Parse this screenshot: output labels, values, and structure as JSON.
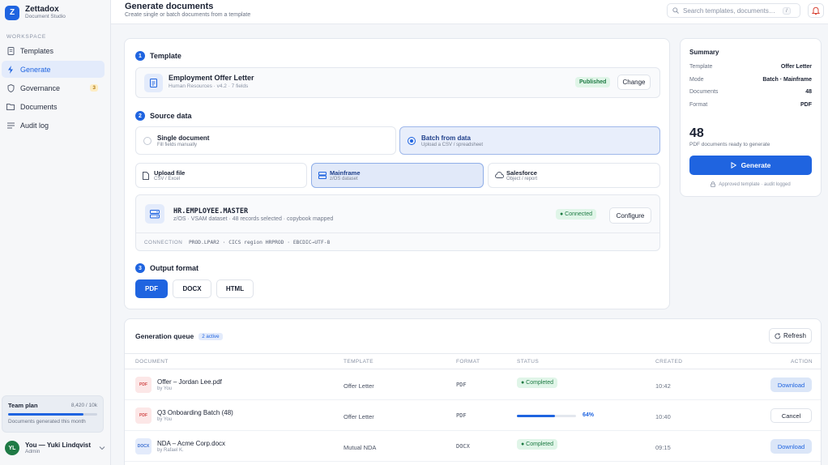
{
  "brand": {
    "name": "Zettadox",
    "subtitle": "Document Studio",
    "logo_letter": "Z"
  },
  "sidebar": {
    "section_label": "WORKSPACE",
    "items": [
      {
        "label": "Templates",
        "icon": "file-icon"
      },
      {
        "label": "Generate",
        "icon": "bolt-icon",
        "active": true
      },
      {
        "label": "Governance",
        "icon": "shield-icon",
        "badge": "3"
      },
      {
        "label": "Documents",
        "icon": "folder-icon"
      },
      {
        "label": "Audit log",
        "icon": "list-icon"
      }
    ],
    "plan": {
      "title": "Team plan",
      "count": "8,420 / 10k",
      "caption": "Documents generated this month",
      "usage_fraction": 0.842
    },
    "user": {
      "initials": "YL",
      "name": "You — Yuki Lindqvist",
      "role": "Admin"
    }
  },
  "header": {
    "title": "Generate documents",
    "subtitle": "Create single or batch documents from a template",
    "search_placeholder": "Search templates, documents…",
    "search_shortcut": "/"
  },
  "template": {
    "step": "1",
    "heading": "Template",
    "name": "Employment Offer Letter",
    "meta": "Human Resources · v4.2 · 7 fields",
    "status": "Published",
    "change_label": "Change"
  },
  "source": {
    "step": "2",
    "heading": "Source data",
    "modes": [
      {
        "title": "Single document",
        "subtitle": "Fill fields manually",
        "selected": false
      },
      {
        "title": "Batch from data",
        "subtitle": "Upload a CSV / spreadsheet",
        "selected": true
      }
    ],
    "sources": [
      {
        "title": "Upload file",
        "subtitle": "CSV / Excel",
        "icon": "file-icon"
      },
      {
        "title": "Mainframe",
        "subtitle": "z/OS dataset",
        "icon": "server-icon",
        "selected": true
      },
      {
        "title": "Salesforce",
        "subtitle": "Object / report",
        "icon": "cloud-icon"
      }
    ],
    "mainframe": {
      "dataset": "HR.EMPLOYEE.MASTER",
      "meta": "z/OS · VSAM dataset · 48 records selected · copybook mapped",
      "status": "● Connected",
      "configure_label": "Configure",
      "connection_label": "CONNECTION",
      "connection_value": "PROD.LPAR2 · CICS region HRPROD · EBCDIC→UTF-8"
    }
  },
  "output": {
    "step": "3",
    "heading": "Output format",
    "formats": [
      "PDF",
      "DOCX",
      "HTML"
    ],
    "selected": "PDF"
  },
  "summary": {
    "title": "Summary",
    "rows": [
      {
        "key": "Template",
        "value": "Offer Letter"
      },
      {
        "key": "Mode",
        "value": "Batch · Mainframe"
      },
      {
        "key": "Documents",
        "value": "48"
      },
      {
        "key": "Format",
        "value": "PDF"
      }
    ],
    "big_number": "48",
    "big_caption": "PDF documents ready to generate",
    "generate_label": "Generate",
    "footer": "Approved template · audit logged"
  },
  "queue": {
    "title": "Generation queue",
    "badge": "2 active",
    "refresh_label": "Refresh",
    "columns": [
      "DOCUMENT",
      "TEMPLATE",
      "FORMAT",
      "STATUS",
      "CREATED",
      "ACTION"
    ],
    "rows": [
      {
        "file_type": "PDF",
        "name": "Offer – Jordan Lee.pdf",
        "by": "by You",
        "template": "Offer Letter",
        "format": "PDF",
        "status": "● Completed",
        "created": "10:42",
        "action": "Download"
      },
      {
        "file_type": "PDF",
        "name": "Q3 Onboarding Batch (48)",
        "by": "by You",
        "template": "Offer Letter",
        "format": "PDF",
        "progress": 0.64,
        "progress_label": "64%",
        "created": "10:40",
        "action": "Cancel"
      },
      {
        "file_type": "DOCX",
        "name": "NDA – Acme Corp.docx",
        "by": "by Rafael K.",
        "template": "Mutual NDA",
        "format": "DOCX",
        "status": "● Completed",
        "created": "09:15",
        "action": "Download"
      }
    ]
  },
  "colors": {
    "accent": "#1f64e0",
    "success": "#1d7a43",
    "success_bg": "#e0f5e8"
  }
}
